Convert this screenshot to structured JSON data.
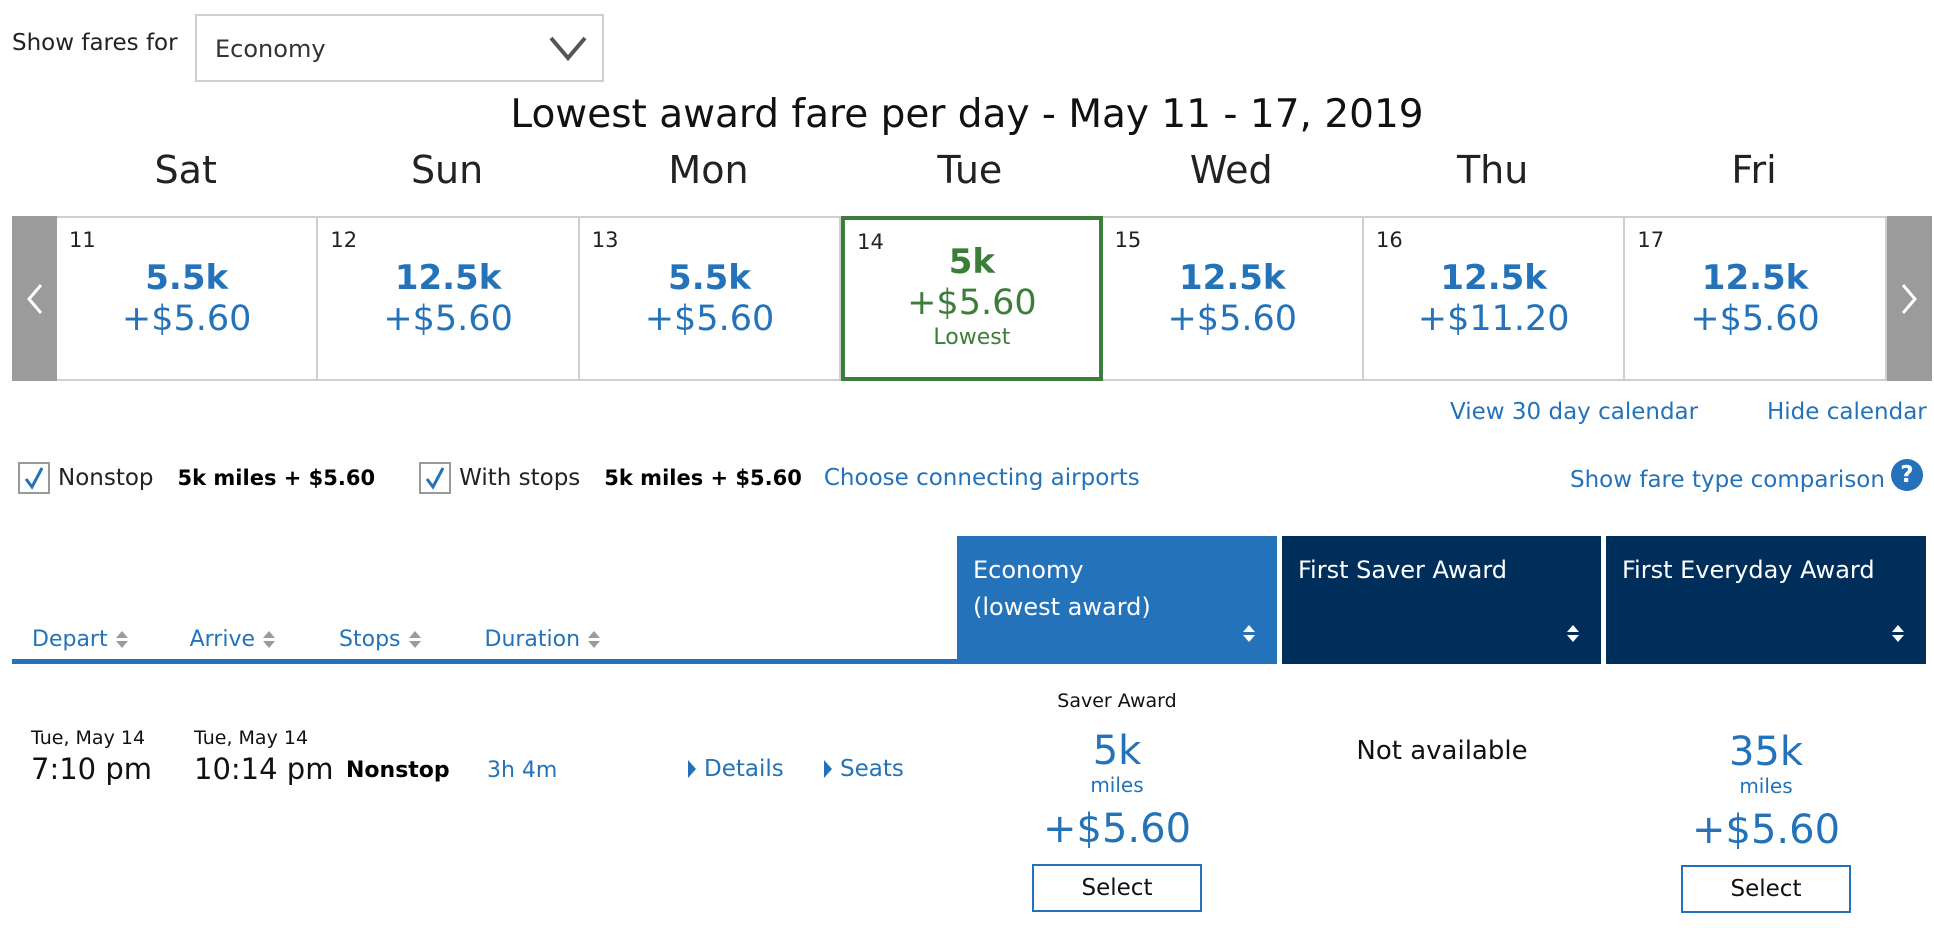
{
  "fare_filter": {
    "label": "Show fares for",
    "selected": "Economy"
  },
  "calendar": {
    "title": "Lowest award fare per day - May 11 - 17, 2019",
    "days": [
      {
        "name": "Sat",
        "date": "11",
        "miles": "5.5k",
        "tax": "+$5.60",
        "lowest": false
      },
      {
        "name": "Sun",
        "date": "12",
        "miles": "12.5k",
        "tax": "+$5.60",
        "lowest": false
      },
      {
        "name": "Mon",
        "date": "13",
        "miles": "5.5k",
        "tax": "+$5.60",
        "lowest": false
      },
      {
        "name": "Tue",
        "date": "14",
        "miles": "5k",
        "tax": "+$5.60",
        "lowest": true,
        "note": "Lowest"
      },
      {
        "name": "Wed",
        "date": "15",
        "miles": "12.5k",
        "tax": "+$5.60",
        "lowest": false
      },
      {
        "name": "Thu",
        "date": "16",
        "miles": "12.5k",
        "tax": "+$11.20",
        "lowest": false
      },
      {
        "name": "Fri",
        "date": "17",
        "miles": "12.5k",
        "tax": "+$5.60",
        "lowest": false
      }
    ],
    "links": {
      "view30": "View 30 day calendar",
      "hide": "Hide calendar"
    },
    "colors": {
      "accent": "#2472b9",
      "lowest": "#3d7d3a",
      "arrow_bg": "#9b9b9b"
    }
  },
  "filters": {
    "nonstop": {
      "label": "Nonstop",
      "checked": true,
      "price": "5k miles + $5.60"
    },
    "with_stops": {
      "label": "With stops",
      "checked": true,
      "price": "5k miles + $5.60"
    },
    "choose_airports": "Choose connecting airports",
    "compare": "Show fare type comparison",
    "help_icon": "?"
  },
  "table": {
    "sort_columns": [
      "Depart",
      "Arrive",
      "Stops",
      "Duration"
    ],
    "fare_columns": [
      {
        "line1": "Economy",
        "line2": "(lowest award)",
        "color": "#2472b9"
      },
      {
        "line1": "First Saver Award",
        "line2": "",
        "color": "#002e5b"
      },
      {
        "line1": "First Everyday Award",
        "line2": "",
        "color": "#002e5b"
      }
    ],
    "rows": [
      {
        "depart_date": "Tue, May 14",
        "depart_time": "7:10 pm",
        "arrive_date": "Tue, May 14",
        "arrive_time": "10:14 pm",
        "stops": "Nonstop",
        "duration": "3h 4m",
        "details": "Details",
        "seats": "Seats",
        "fares": [
          {
            "label": "Saver Award",
            "miles": "5k",
            "unit": "miles",
            "tax": "+$5.60",
            "button": "Select"
          },
          {
            "status": "Not available"
          },
          {
            "label": "",
            "miles": "35k",
            "unit": "miles",
            "tax": "+$5.60",
            "button": "Select"
          }
        ]
      }
    ]
  }
}
